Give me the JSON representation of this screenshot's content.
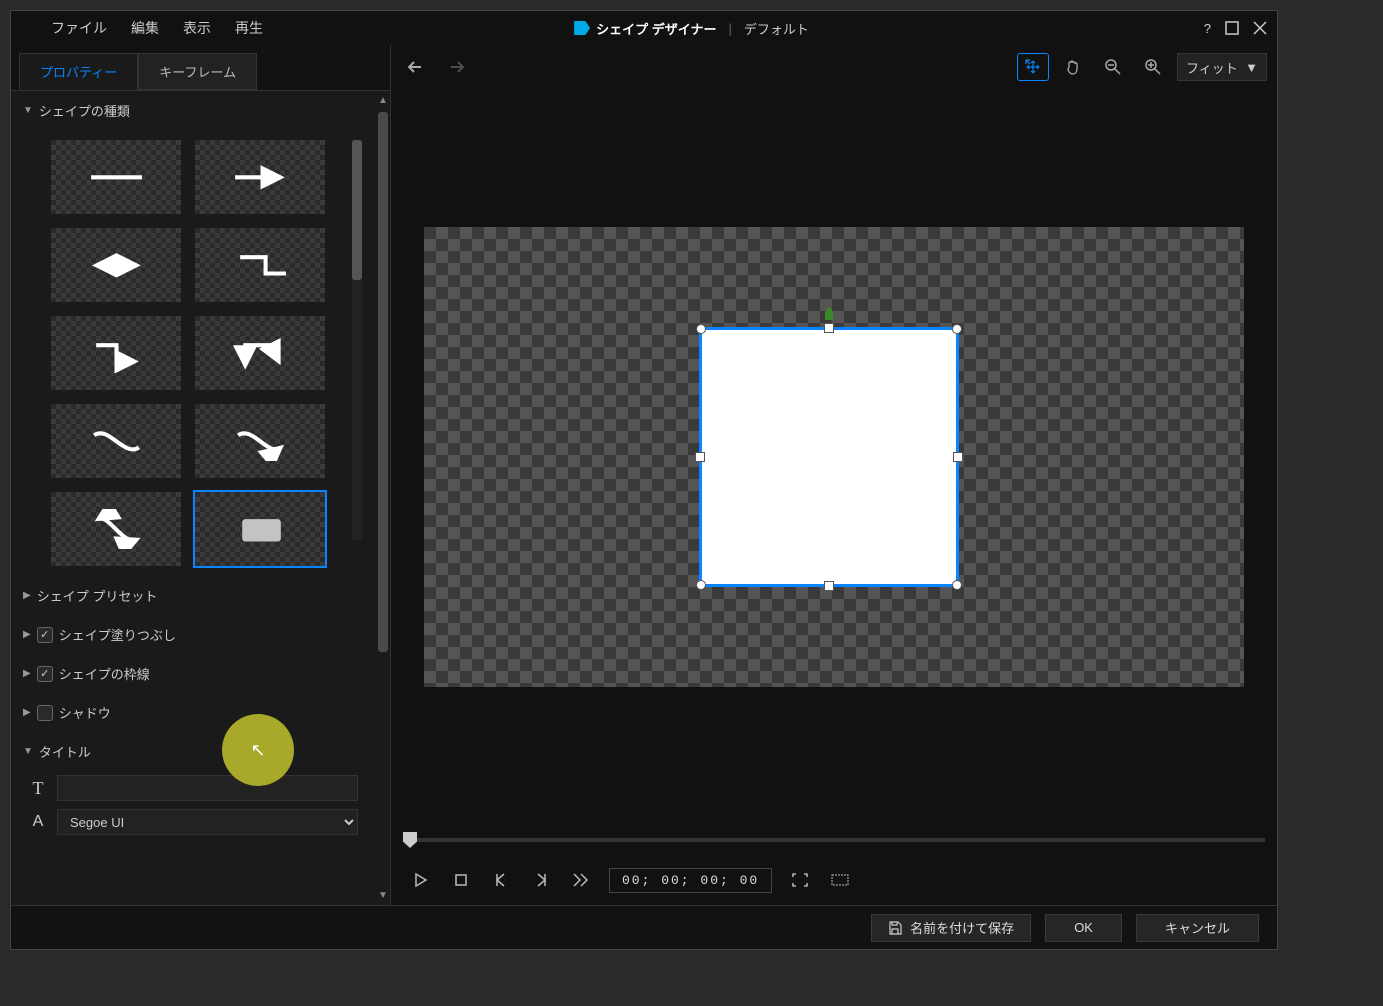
{
  "menubar": {
    "file": "ファイル",
    "edit": "編集",
    "view": "表示",
    "play": "再生"
  },
  "title": {
    "app": "シェイプ デザイナー",
    "sep": "|",
    "sub": "デフォルト"
  },
  "tabs": {
    "properties": "プロパティー",
    "keyframes": "キーフレーム"
  },
  "sections": {
    "shape_type": "シェイプの種類",
    "shape_preset": "シェイプ プリセット",
    "shape_fill": "シェイプ塗りつぶし",
    "shape_border": "シェイプの枠線",
    "shadow": "シャドウ",
    "title_section": "タイトル"
  },
  "shape_library": [
    "line",
    "arrow-right",
    "arrow-both",
    "step",
    "step-arrow",
    "turn-arrow",
    "curve",
    "curve-arrow",
    "curve-turn-arrow",
    "rectangle"
  ],
  "shape_selected_index": 9,
  "fill_checked": true,
  "border_checked": true,
  "shadow_checked": false,
  "title_text": "",
  "font_value": "Segoe UI",
  "toolbar": {
    "fit": "フィット"
  },
  "timecode": "00; 00; 00; 00",
  "footer": {
    "save_as": "名前を付けて保存",
    "ok": "OK",
    "cancel": "キャンセル"
  }
}
